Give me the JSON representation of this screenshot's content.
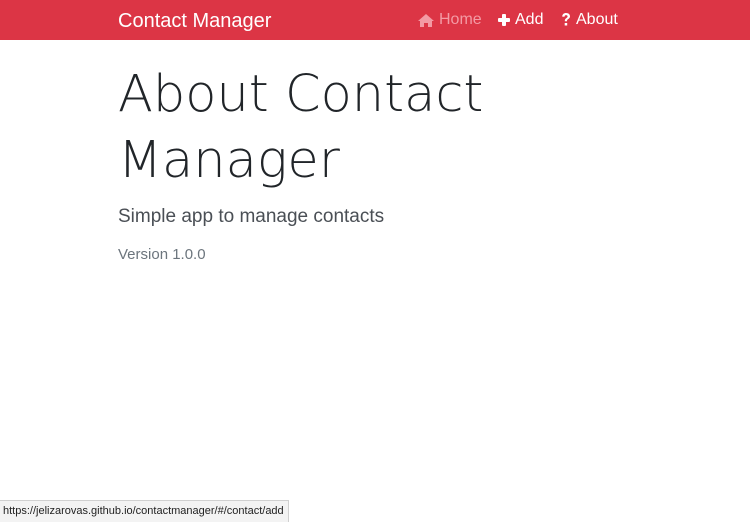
{
  "navbar": {
    "brand": "Contact Manager",
    "items": [
      {
        "label": "Home",
        "icon": "home-icon",
        "active": true
      },
      {
        "label": "Add",
        "icon": "plus-icon"
      },
      {
        "label": "About",
        "icon": "question-icon"
      }
    ]
  },
  "page": {
    "title": "About Contact Manager",
    "subtitle": "Simple app to manage contacts",
    "version": "Version 1.0.0"
  },
  "status_bar": {
    "url": "https://jelizarovas.github.io/contactmanager/#/contact/add"
  },
  "colors": {
    "navbar_bg": "#dc3545",
    "nav_active": "#f39aa4",
    "text_dark": "#212529",
    "text_muted": "#6c757d"
  }
}
